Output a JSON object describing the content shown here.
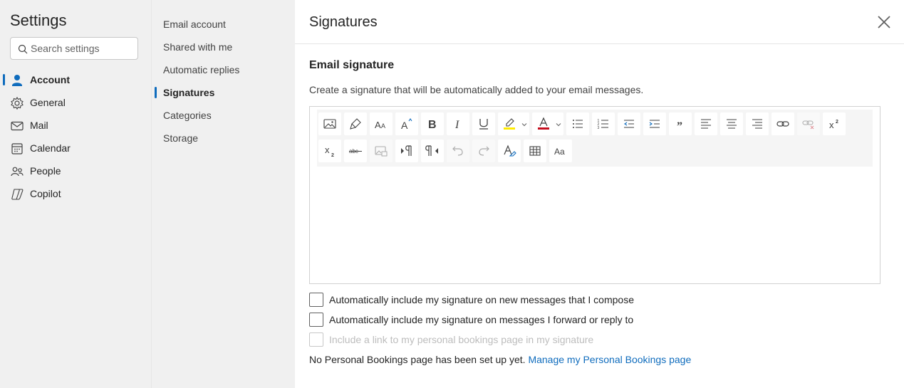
{
  "sidebar": {
    "title": "Settings",
    "search_placeholder": "Search settings",
    "items": [
      {
        "label": "Account",
        "icon": "person-icon"
      },
      {
        "label": "General",
        "icon": "gear-icon"
      },
      {
        "label": "Mail",
        "icon": "mail-icon"
      },
      {
        "label": "Calendar",
        "icon": "calendar-icon"
      },
      {
        "label": "People",
        "icon": "people-icon"
      },
      {
        "label": "Copilot",
        "icon": "copilot-icon"
      }
    ],
    "active_item": "Account"
  },
  "subnav": {
    "items": [
      {
        "label": "Email account"
      },
      {
        "label": "Shared with me"
      },
      {
        "label": "Automatic replies"
      },
      {
        "label": "Signatures"
      },
      {
        "label": "Categories"
      },
      {
        "label": "Storage"
      }
    ],
    "active_item": "Signatures"
  },
  "main": {
    "title": "Signatures",
    "section_title": "Email signature",
    "description": "Create a signature that will be automatically added to your email messages.",
    "toolbar_row1": [
      "insert-picture-icon",
      "format-painter-icon",
      "font-size-icon",
      "font-grow-icon",
      "bold-icon",
      "italic-icon",
      "underline-icon",
      "highlight-icon",
      "font-color-icon",
      "bullets-icon",
      "numbering-icon",
      "decrease-indent-icon",
      "increase-indent-icon",
      "quote-icon",
      "align-left-icon",
      "align-center-icon",
      "align-right-icon",
      "link-icon",
      "remove-link-icon",
      "superscript-icon"
    ],
    "toolbar_row2": [
      "subscript-icon",
      "strikethrough-icon",
      "picture-disabled-icon",
      "ltr-icon",
      "rtl-icon",
      "undo-icon",
      "redo-icon",
      "clear-format-icon",
      "table-icon",
      "change-case-icon"
    ],
    "checkboxes": [
      {
        "label": "Automatically include my signature on new messages that I compose",
        "checked": false,
        "enabled": true
      },
      {
        "label": "Automatically include my signature on messages I forward or reply to",
        "checked": false,
        "enabled": true
      },
      {
        "label": "Include a link to my personal bookings page in my signature",
        "checked": false,
        "enabled": false
      }
    ],
    "footer_text": "No Personal Bookings page has been set up yet.",
    "footer_link": "Manage my Personal Bookings page"
  },
  "colors": {
    "accent": "#0f6cbd",
    "highlight": "#ffeb00",
    "font_color": "#c50f1f",
    "nav_bg": "#f0f0f0"
  }
}
